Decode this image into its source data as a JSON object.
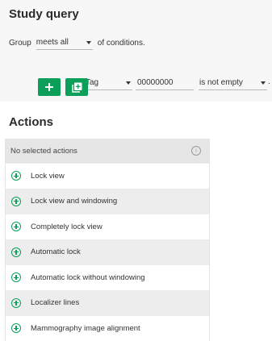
{
  "study_query": {
    "title": "Study query",
    "group_prefix": "Group",
    "group_mode": "meets all",
    "group_suffix": "of conditions.",
    "condition": {
      "type": "Tag",
      "value": "00000000",
      "operator": "is not empty",
      "trailing": "."
    },
    "add_icon": "plus-icon",
    "add_group_icon": "add-box-icon"
  },
  "actions": {
    "title": "Actions",
    "header": "No selected actions",
    "header_icon": "info-icon",
    "item_icon": "plus-circle-icon",
    "items": [
      "Lock view",
      "Lock view and windowing",
      "Completely lock view",
      "Automatic lock",
      "Automatic lock without windowing",
      "Localizer lines",
      "Mammography image alignment"
    ]
  },
  "colors": {
    "accent": "#0b9f5a",
    "panel_bg": "#f7f7f7",
    "alt_row": "#ededed"
  }
}
